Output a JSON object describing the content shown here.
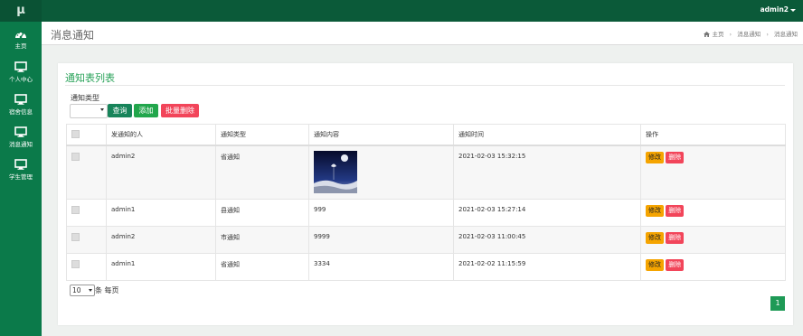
{
  "app": {
    "logo_text": "μ",
    "user": "admin2"
  },
  "sidebar": {
    "items": [
      {
        "label": "主页",
        "icon": "dashboard-icon"
      },
      {
        "label": "个人中心",
        "icon": "monitor-icon"
      },
      {
        "label": "宿舍信息",
        "icon": "monitor-icon"
      },
      {
        "label": "消息通知",
        "icon": "monitor-icon"
      },
      {
        "label": "学生管理",
        "icon": "monitor-icon"
      }
    ]
  },
  "header": {
    "title": "消息通知",
    "breadcrumb": [
      "主页",
      "消息通知",
      "消息通知"
    ]
  },
  "card": {
    "title": "通知表列表",
    "filter_label": "通知类型",
    "filter_value": "",
    "buttons": {
      "query": "查询",
      "add": "添加",
      "batch_delete": "批量删除"
    }
  },
  "table": {
    "columns": [
      "",
      "发通知的人",
      "通知类型",
      "通知内容",
      "通知时间",
      "操作"
    ],
    "rows": [
      {
        "sender": "admin2",
        "type": "省通知",
        "content": "",
        "time": "2021-02-03 15:32:15"
      },
      {
        "sender": "admin1",
        "type": "县通知",
        "content": "999",
        "time": "2021-02-03 15:27:14"
      },
      {
        "sender": "admin2",
        "type": "市通知",
        "content": "9999",
        "time": "2021-02-03 11:00:45"
      },
      {
        "sender": "admin1",
        "type": "省通知",
        "content": "3334",
        "time": "2021-02-02 11:15:59"
      }
    ],
    "actions": {
      "edit": "修改",
      "delete": "删除"
    }
  },
  "pagination": {
    "page_size": "10",
    "per_page_text": "条 每页",
    "current_page": "1"
  },
  "colors": {
    "topbar": "#0b5a39",
    "sidebar": "#0b7a4a",
    "accent": "#2aa35a",
    "danger": "#f2455a",
    "warning": "#f5a400"
  }
}
